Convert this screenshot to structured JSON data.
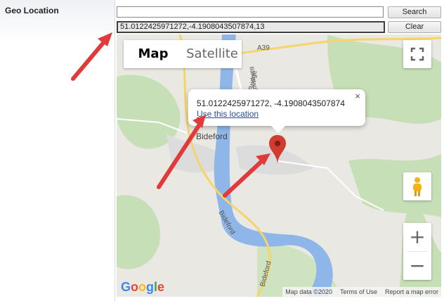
{
  "form": {
    "field_label": "Geo Location",
    "search_value": "",
    "coords_value": "51.0122425971272,-4.1908043507874,13",
    "search_button": "Search",
    "clear_button": "Clear"
  },
  "map": {
    "map_type": {
      "map": "Map",
      "satellite": "Satellite",
      "selected": "Map"
    },
    "infowindow": {
      "coords": "51.0122425971272, -4.1908043507874",
      "link": "Use this location",
      "close": "×"
    },
    "labels": {
      "town": "Bideford",
      "road_a39": "A39",
      "road_bridge": "Bridge",
      "road_barnstaple": "Barnstaple",
      "river_label": "Bideford",
      "road_bideford2": "Bideford"
    },
    "zoom": {
      "in": "+",
      "out": "−"
    },
    "attribution": {
      "map_data": "Map data ©2020",
      "terms": "Terms of Use",
      "report": "Report a map error"
    },
    "google_logo": [
      "G",
      "o",
      "o",
      "g",
      "l",
      "e"
    ]
  },
  "colors": {
    "arrow": "#e03a3a",
    "water": "#8fb6e8",
    "green": "#c7dfb7",
    "road_yellow": "#f5d56a",
    "marker": "#d23b2f",
    "link": "#2a4d9a"
  },
  "icons": [
    "fullscreen-icon",
    "pegman-icon",
    "marker-icon",
    "close-icon"
  ]
}
